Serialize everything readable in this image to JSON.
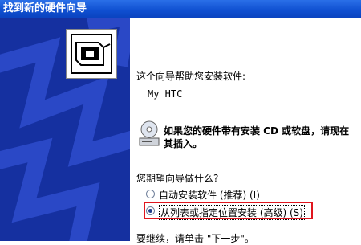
{
  "window": {
    "title": "找到新的硬件向导"
  },
  "intro": "这个向导帮助您安装软件:",
  "device_name": "My HTC",
  "cd_notice": {
    "line1": "如果您的硬件带有安装 CD 或软盘，请现在",
    "line2": "其插入。"
  },
  "question": "您期望向导做什么?",
  "options": [
    {
      "label": "自动安装软件 (推荐) (I)",
      "selected": false
    },
    {
      "label": "从列表或指定位置安装 (高级) (S)",
      "selected": true
    }
  ],
  "footer": "要继续，请单击 \"下一步\"。",
  "colors": {
    "title_bar": "#0f4fd0",
    "side_panel": "#1530a0",
    "highlight_border": "#e0161e"
  },
  "icons": [
    "hardware-wizard-icon",
    "cd-drive-icon"
  ]
}
